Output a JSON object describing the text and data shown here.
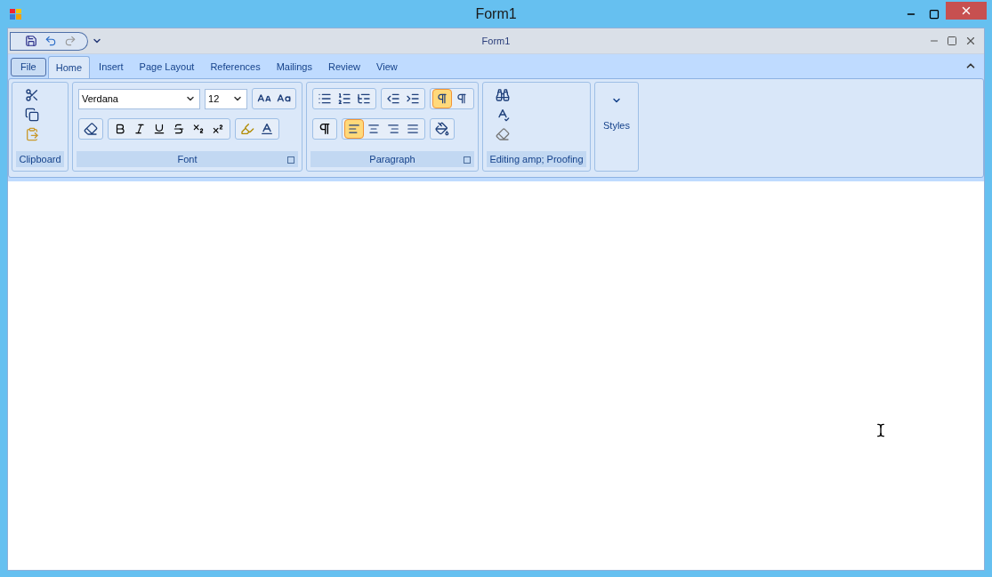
{
  "window": {
    "title": "Form1"
  },
  "inner_window": {
    "title": "Form1"
  },
  "file_button": {
    "label": "File"
  },
  "tabs": [
    {
      "label": "Home",
      "selected": true
    },
    {
      "label": "Insert",
      "selected": false
    },
    {
      "label": "Page Layout",
      "selected": false
    },
    {
      "label": "References",
      "selected": false
    },
    {
      "label": "Mailings",
      "selected": false
    },
    {
      "label": "Review",
      "selected": false
    },
    {
      "label": "View",
      "selected": false
    }
  ],
  "groups": {
    "clipboard": {
      "label": "Clipboard"
    },
    "font": {
      "label": "Font",
      "font_name": "Verdana",
      "font_size": "12"
    },
    "paragraph": {
      "label": "Paragraph",
      "buttons": [
        {
          "kind": "ltr",
          "selected": true
        },
        {
          "kind": "rtl",
          "selected": false
        },
        {
          "kind": "align-left",
          "selected": true
        },
        {
          "kind": "align-center",
          "selected": false
        },
        {
          "kind": "align-right",
          "selected": false
        },
        {
          "kind": "justify",
          "selected": false
        }
      ]
    },
    "editing": {
      "label": "Editing amp; Proofing"
    },
    "styles": {
      "label": "Styles"
    }
  }
}
